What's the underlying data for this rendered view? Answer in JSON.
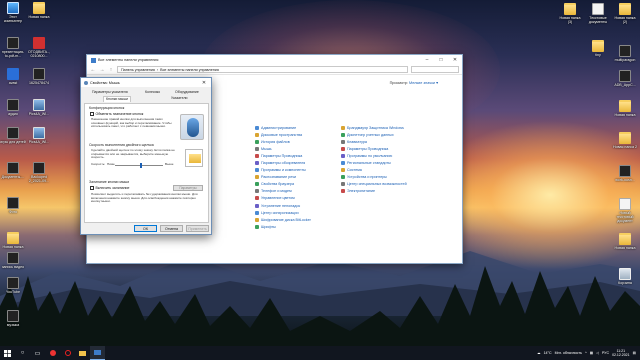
{
  "desktop": {
    "left_icons": [
      {
        "label": "Этот компьютер",
        "icon": "computer-icon"
      },
      {
        "label": "Новая папка",
        "icon": "folder-icon"
      },
      {
        "label": "презентация-to-pdf-m...",
        "icon": "app-icon"
      },
      {
        "label": "ОТОДВИГА.., 0210800...",
        "icon": "pdf-icon"
      },
      {
        "label": "avast",
        "icon": "avast-icon"
      },
      {
        "label": "1625478474",
        "icon": "app-icon"
      },
      {
        "label": "аудио",
        "icon": "app-icon"
      },
      {
        "label": "Pics4A_WI...",
        "icon": "image-icon"
      },
      {
        "label": "игры для детей",
        "icon": "app-icon"
      },
      {
        "label": "Pics4A_WI...",
        "icon": "image-icon"
      },
      {
        "label": "Документы-...",
        "icon": "app-icon"
      },
      {
        "label": "Backuped 2_2021-09...",
        "icon": "app-icon"
      },
      {
        "label": "Фото",
        "icon": "app-icon"
      },
      {
        "label": "Новая папка",
        "icon": "folder-icon"
      },
      {
        "label": "запись видео",
        "icon": "app-icon"
      },
      {
        "label": "YouTube",
        "icon": "app-icon"
      },
      {
        "label": "музыка",
        "icon": "app-icon"
      }
    ],
    "right_icons": [
      {
        "label": "Новая папка (3)",
        "icon": "folder-icon"
      },
      {
        "label": "Текстовые документы",
        "icon": "document-icon"
      },
      {
        "label": "Новая папка (2)",
        "icon": "folder-icon"
      },
      {
        "label": "tiny",
        "icon": "folder-icon"
      },
      {
        "label": "multiparagon",
        "icon": "app-icon"
      },
      {
        "label": "ADB_AppC...",
        "icon": "app-icon"
      },
      {
        "label": "Новая папка",
        "icon": "folder-icon"
      },
      {
        "label": "Новая папка 2",
        "icon": "folder-icon"
      },
      {
        "label": "work-ousn...",
        "icon": "app-icon"
      },
      {
        "label": "Новый текстовый документ",
        "icon": "document-icon"
      },
      {
        "label": "Новая папка",
        "icon": "folder-icon"
      },
      {
        "label": "Корзина",
        "icon": "recycle-bin-icon"
      }
    ]
  },
  "control_panel": {
    "title": "Все элементы панели управления",
    "breadcrumb": [
      "Панель управления",
      "Все элементы панели управления"
    ],
    "view_label": "Просмотр:",
    "view_value": "Мелкие значки ▾",
    "columns": [
      [],
      [
        "Администрирование",
        "Дисковые пространства",
        "История файлов",
        "Мышь",
        "Параметры Проводника",
        "Параметры обозревателя",
        "Программы и компоненты",
        "Распознавание речи",
        "Свойства браузера",
        "Телефон и модем",
        "Управление цветом",
        "Устранение неполадок",
        "Центр синхронизации",
        "Шифрование диска BitLocker",
        "Шрифты"
      ],
      [
        "Брандмауэр Защитника Windows",
        "Диспетчер учетных данных",
        "Клавиатура",
        "Параметры Проводника",
        "Программы по умолчанию",
        "Региональные стандарты",
        "Система",
        "Устройства и принтеры",
        "Центр специальных возможностей",
        "Электропитание"
      ]
    ]
  },
  "mouse_dialog": {
    "title": "Свойства: Мышь",
    "tabs": [
      "Параметры указателя",
      "Колесико",
      "Оборудование",
      "Кнопки мыши",
      "Указатели"
    ],
    "buttons_group": "Конфигурация кнопок",
    "swap_label": "Обменять назначение кнопок",
    "swap_desc": "Назначение правой кнопки для выполнения таких основных функций, как выбор и перетаскивание. Чтобы использовать пакет, что работает с левшами мыши.",
    "dbl_group": "Скорость выполнения двойного щелчка",
    "dbl_desc": "Сделайте двойной щелчок по этому значку. Если папка не открывается или не закрывается, выберите меньшую скорость.",
    "speed_label": "Скорость:",
    "speed_low": "Ниже",
    "speed_high": "Выше",
    "speed_fraction": 0.55,
    "lock_group": "Залипание кнопки мыши",
    "lock_label": "Включить залипание",
    "lock_params": "Параметры",
    "lock_desc": "Позволяет выделять и перетаскивать без удерживания кнопки мыши. Для включения нажмите кнопку мыши. Для освобождения нажмите повторно кнопку мыши.",
    "ok": "ОК",
    "cancel": "Отмена",
    "apply": "Применить"
  },
  "taskbar": {
    "temperature": "14°C",
    "weather": "Мгл. облачность",
    "language": "РУС",
    "time": "11:21",
    "date": "02.12.2021"
  }
}
